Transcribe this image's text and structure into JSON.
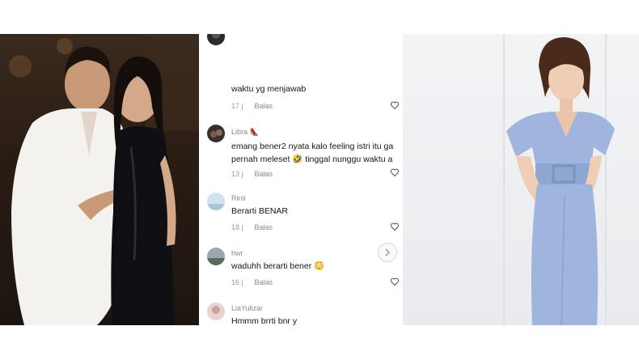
{
  "comments": [
    {
      "username": "",
      "lines": [
        "waktu yg menjawab"
      ],
      "age": "17 j",
      "reply_label": "Balas",
      "avatar_icon": "dark-avatar"
    },
    {
      "username": "Libra 👠",
      "lines": [
        "emang bener2 nyata kalo feeling istri itu ga",
        "pernah meleset 🤣 tinggal nunggu waktu a"
      ],
      "age": "13 j",
      "reply_label": "Balas",
      "avatar_icon": "dark-avatar"
    },
    {
      "username": "Rinii",
      "lines": [
        "Berarti BENAR"
      ],
      "age": "18 j",
      "reply_label": "Balas",
      "avatar_icon": "light-avatar"
    },
    {
      "username": "hwr",
      "lines": [
        "waduhh berarti bener 😳"
      ],
      "age": "16 j",
      "reply_label": "Balas",
      "avatar_icon": "landscape-avatar"
    },
    {
      "username": "LiaYulizar",
      "lines": [
        "Hmmm brrti bnr y"
      ],
      "age": "",
      "reply_label": "",
      "avatar_icon": "pink-avatar"
    }
  ],
  "icons": {
    "like": "heart-outline-icon",
    "next": "chevron-right-icon"
  },
  "colors": {
    "left_photo_bg": "#2a1d14",
    "right_photo_bg": "#eceef1",
    "dress_blue": "#9fb5dd"
  }
}
